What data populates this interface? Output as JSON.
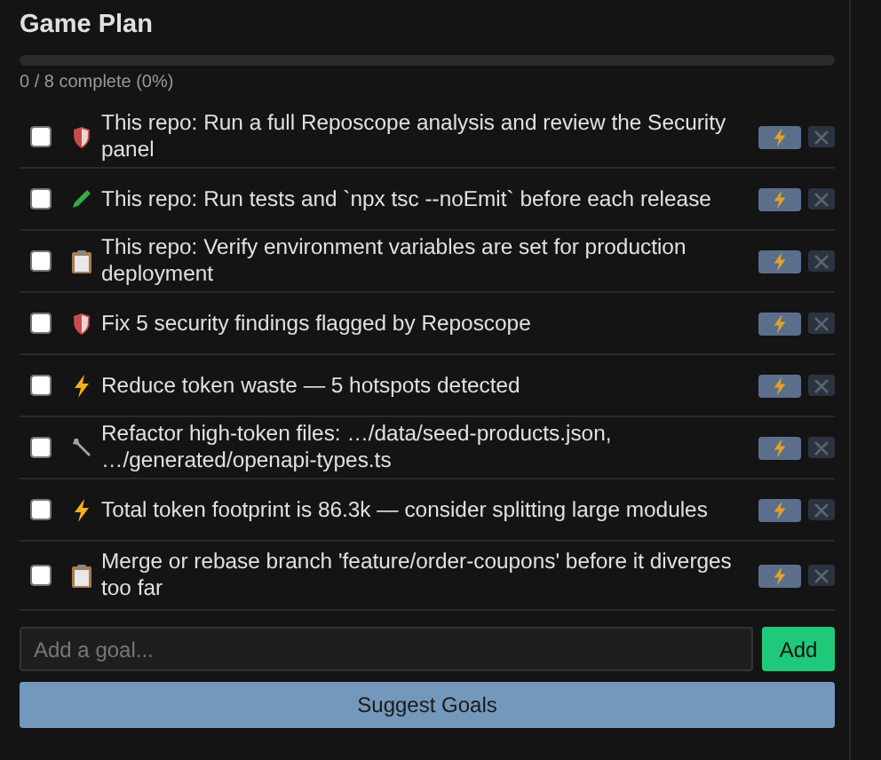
{
  "title": "Game Plan",
  "progress": {
    "level": 0,
    "text": "0 / 8 complete (0%)"
  },
  "goals": [
    {
      "text": "This repo: Run a full Reposcope analysis and review the Security panel",
      "kind": "shield",
      "checked": false
    },
    {
      "text": "This repo: Run tests and `npx tsc --noEmit` before each release",
      "kind": "pen",
      "checked": false
    },
    {
      "text": "This repo: Verify environment variables are set for production deployment",
      "kind": "clipboard",
      "checked": false
    },
    {
      "text": "Fix 5 security findings flagged by Reposcope",
      "kind": "shield",
      "checked": false
    },
    {
      "text": "Reduce token waste — 5 hotspots detected",
      "kind": "bolt",
      "checked": false
    },
    {
      "text": "Refactor high-token files: …/data/seed-products.json, …/generated/openapi-types.ts",
      "kind": "wrench",
      "checked": false
    },
    {
      "text": "Total token footprint is 86.3k — consider splitting large modules",
      "kind": "bolt",
      "checked": false
    },
    {
      "text": "Merge or rebase branch 'feature/order-coupons' before it diverges too far",
      "kind": "clipboard",
      "checked": false
    }
  ],
  "new_goal": {
    "placeholder": "Add a goal..."
  },
  "add_button": "Add",
  "suggest_button": "Suggest Goals"
}
